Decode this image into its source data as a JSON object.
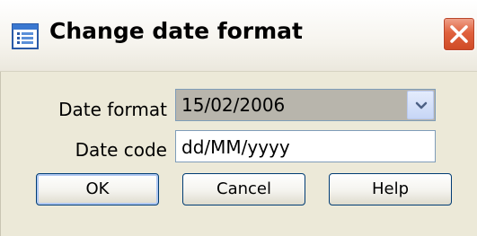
{
  "window": {
    "title": "Change date format",
    "icon": "calendar-list-icon",
    "close_icon": "close-x-icon"
  },
  "form": {
    "date_format_label": "Date format",
    "date_format_value": "15/02/2006",
    "date_code_label": "Date code",
    "date_code_value": "dd/MM/yyyy"
  },
  "buttons": {
    "ok": "OK",
    "cancel": "Cancel",
    "help": "Help"
  },
  "colors": {
    "close_button": "#e0623e",
    "panel_background": "#ece9d8",
    "field_border": "#7f9db9"
  }
}
